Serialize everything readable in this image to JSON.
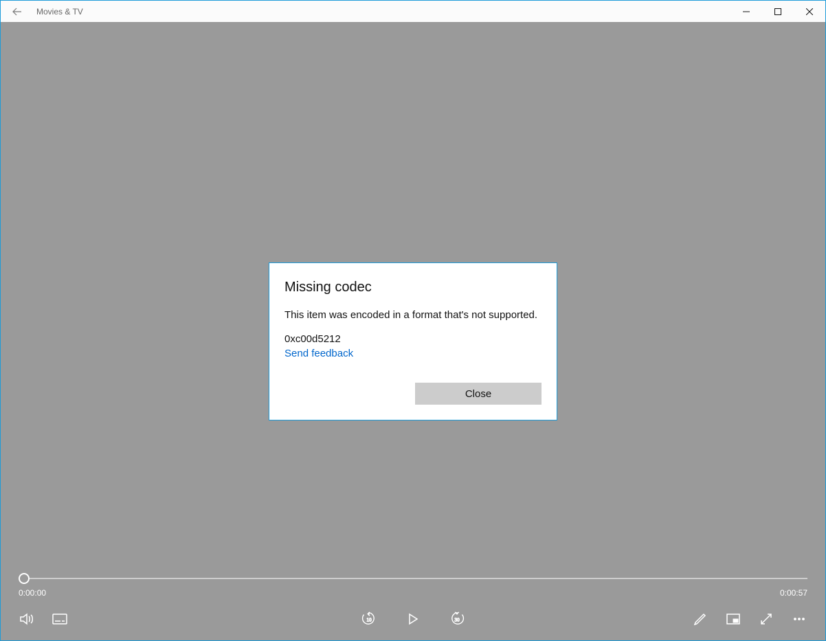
{
  "titlebar": {
    "app_name": "Movies & TV"
  },
  "dialog": {
    "title": "Missing codec",
    "message": "This item was encoded in a format that's not supported.",
    "error_code": "0xc00d5212",
    "feedback_link": "Send feedback",
    "close_label": "Close"
  },
  "player": {
    "current_time": "0:00:00",
    "total_time": "0:00:57",
    "skip_back_seconds": "10",
    "skip_forward_seconds": "30"
  }
}
